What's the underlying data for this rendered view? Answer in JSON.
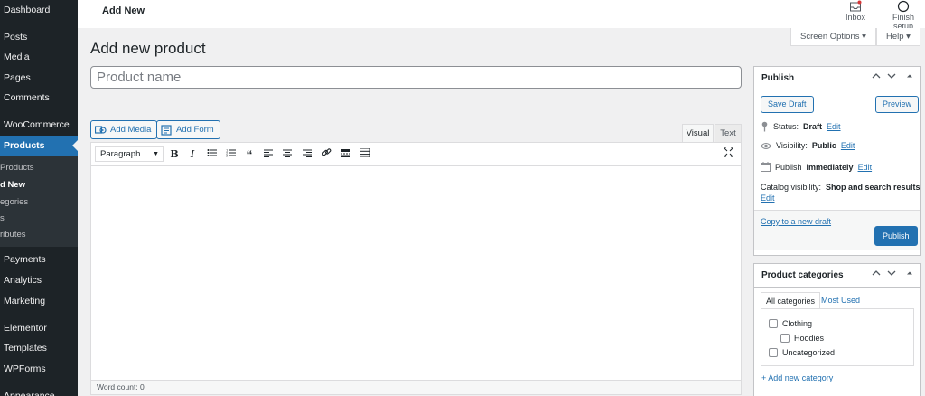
{
  "sidebar": {
    "items": [
      {
        "label": "Dashboard"
      },
      {
        "label": "Posts"
      },
      {
        "label": "Media"
      },
      {
        "label": "Pages"
      },
      {
        "label": "Comments"
      },
      {
        "label": "WooCommerce"
      },
      {
        "label": "Products"
      },
      {
        "label": "Payments"
      },
      {
        "label": "Analytics"
      },
      {
        "label": "Marketing"
      },
      {
        "label": "Elementor"
      },
      {
        "label": "Templates"
      },
      {
        "label": "WPForms"
      },
      {
        "label": "Appearance"
      }
    ],
    "subitems": [
      {
        "label": "Products"
      },
      {
        "label": "d New"
      },
      {
        "label": "egories"
      },
      {
        "label": "s"
      },
      {
        "label": "ributes"
      }
    ]
  },
  "topbar": {
    "title": "Add New",
    "inbox_label": "Inbox",
    "finish_setup_label": "Finish setup"
  },
  "screen_options": {
    "label": "Screen Options ▾"
  },
  "help": {
    "label": "Help ▾"
  },
  "page": {
    "title": "Add new product",
    "product_name_placeholder": "Product name"
  },
  "editor": {
    "add_media_label": "Add Media",
    "add_form_label": "Add Form",
    "tab_visual": "Visual",
    "tab_text": "Text",
    "format_select": "Paragraph",
    "word_count": "Word count: 0"
  },
  "publish_box": {
    "title": "Publish",
    "save_draft": "Save Draft",
    "preview": "Preview",
    "status_label": "Status:",
    "status_value": "Draft",
    "visibility_label": "Visibility:",
    "visibility_value": "Public",
    "publish_label": "Publish",
    "publish_value": "immediately",
    "edit": "Edit",
    "catalog_label": "Catalog visibility:",
    "catalog_value": "Shop and search results",
    "copy_draft": "Copy to a new draft",
    "publish_button": "Publish"
  },
  "categories_box": {
    "title": "Product categories",
    "tab_all": "All categories",
    "tab_most_used": "Most Used",
    "items": [
      {
        "label": "Clothing",
        "checked": false
      },
      {
        "label": "Hoodies",
        "checked": false
      },
      {
        "label": "Uncategorized",
        "checked": false
      }
    ],
    "add_new": "+ Add new category"
  },
  "colors": {
    "sidebar_bg": "#1d2327",
    "accent": "#2271b1",
    "page_bg": "#f0f0f1"
  }
}
